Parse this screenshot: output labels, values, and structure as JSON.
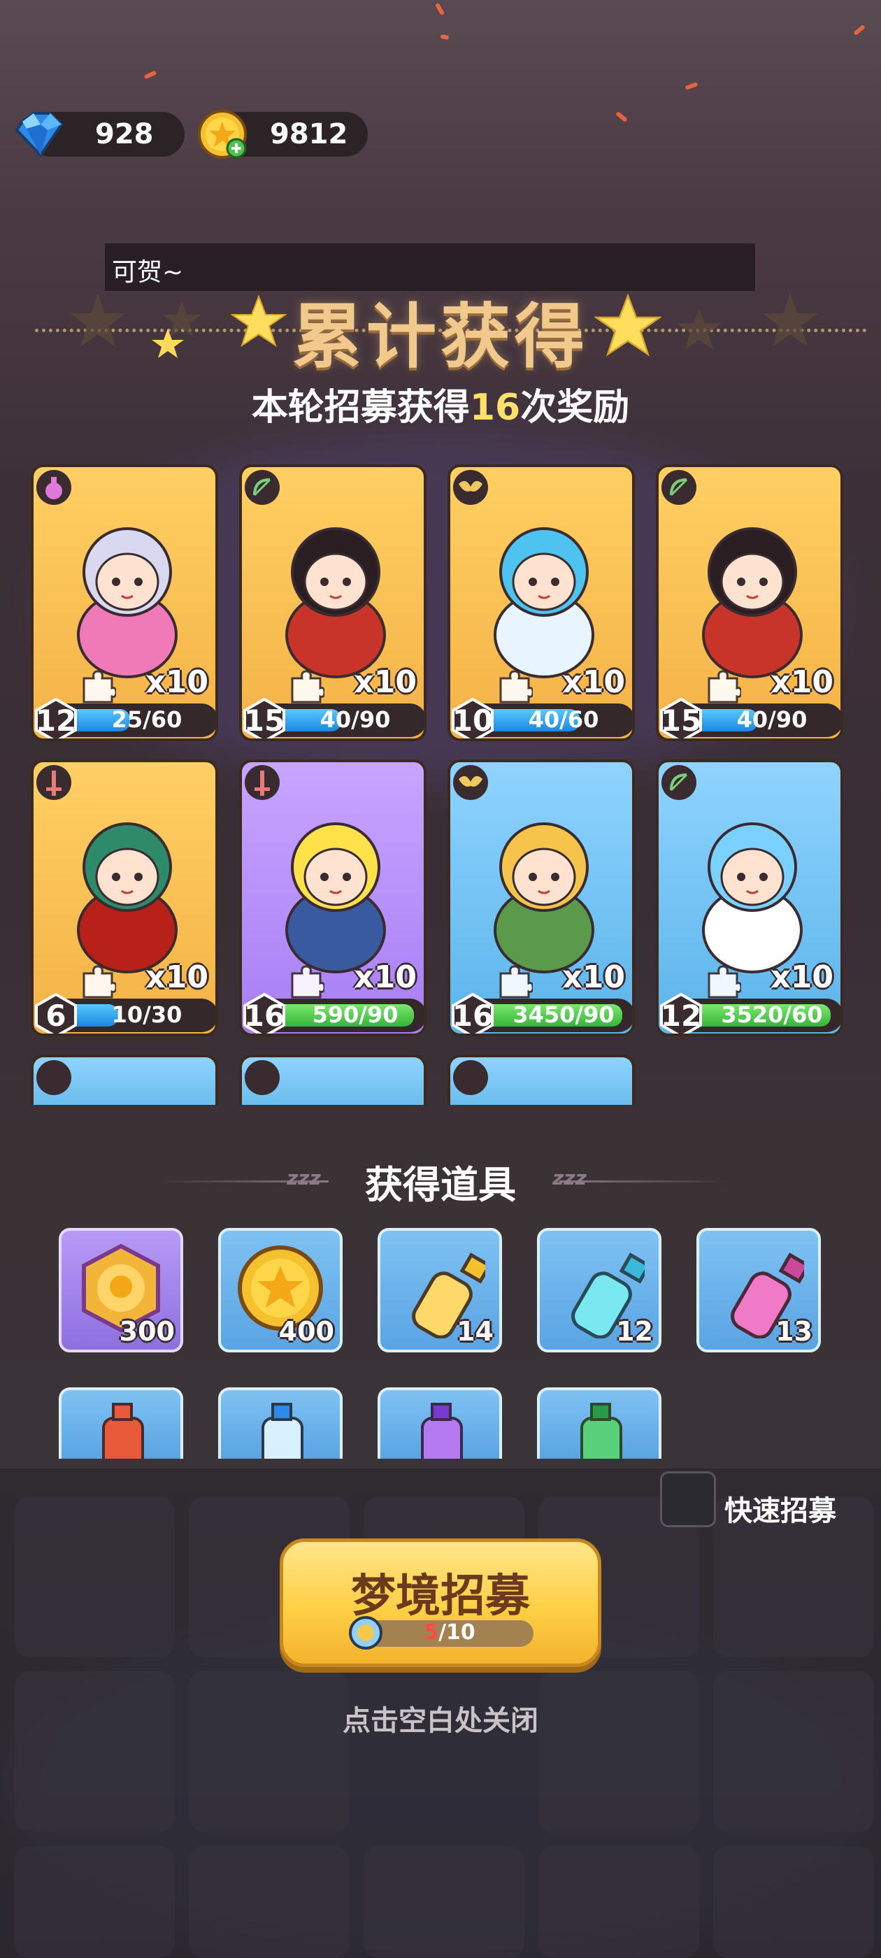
{
  "currency": {
    "gems": "928",
    "coins": "9812"
  },
  "notice": {
    "text": "可贺~"
  },
  "header": {
    "title": "累计获得",
    "subtitle_prefix": "本轮招募获得",
    "subtitle_count": "16",
    "subtitle_suffix": "次奖励"
  },
  "heroes": [
    {
      "role_icon": "potion-role-icon",
      "rarity": "gold",
      "count": "x10",
      "level": "12",
      "progress": "25/60",
      "progress_fraction": 0.42,
      "bar_color": "blue"
    },
    {
      "role_icon": "bow-role-icon",
      "rarity": "gold",
      "count": "x10",
      "level": "15",
      "progress": "40/90",
      "progress_fraction": 0.44,
      "bar_color": "blue"
    },
    {
      "role_icon": "wing-role-icon",
      "rarity": "gold",
      "count": "x10",
      "level": "10",
      "progress": "40/60",
      "progress_fraction": 0.67,
      "bar_color": "blue"
    },
    {
      "role_icon": "bow-role-icon",
      "rarity": "gold",
      "count": "x10",
      "level": "15",
      "progress": "40/90",
      "progress_fraction": 0.44,
      "bar_color": "blue"
    },
    {
      "role_icon": "sword-role-icon",
      "rarity": "gold",
      "count": "x10",
      "level": "6",
      "progress": "10/30",
      "progress_fraction": 0.33,
      "bar_color": "blue"
    },
    {
      "role_icon": "sword-role-icon",
      "rarity": "purple",
      "count": "x10",
      "level": "16",
      "progress": "590/90",
      "progress_fraction": 1.0,
      "bar_color": "green"
    },
    {
      "role_icon": "wing-role-icon",
      "rarity": "blue",
      "count": "x10",
      "level": "16",
      "progress": "3450/90",
      "progress_fraction": 1.0,
      "bar_color": "green"
    },
    {
      "role_icon": "bow-role-icon",
      "rarity": "blue",
      "count": "x10",
      "level": "12",
      "progress": "3520/60",
      "progress_fraction": 1.0,
      "bar_color": "green"
    }
  ],
  "heroes_partial_row": [
    "wing-role-icon",
    "magic-role-icon",
    "bow-role-icon"
  ],
  "items_section": {
    "title": "获得道具"
  },
  "items": [
    {
      "icon": "hero-medal-icon",
      "rarity": "purple",
      "qty": "300"
    },
    {
      "icon": "gold-coin-icon",
      "rarity": "blue",
      "qty": "400"
    },
    {
      "icon": "yellow-bottle-icon",
      "rarity": "blue",
      "qty": "14"
    },
    {
      "icon": "cyan-bottle-icon",
      "rarity": "blue",
      "qty": "12"
    },
    {
      "icon": "pink-bottle-icon",
      "rarity": "blue",
      "qty": "13"
    }
  ],
  "items_partial_row": [
    "red-bottle-icon",
    "blue-bottle-icon",
    "purple-bottle-icon",
    "green-bottle-icon"
  ],
  "quick_recruit": {
    "label": "快速招募",
    "checked": false
  },
  "recruit_button": {
    "label": "梦境招募",
    "current": "5",
    "total": "/10"
  },
  "close_hint": "点击空白处关闭",
  "colors": {
    "title_gold": "#f1c98d",
    "highlight_yellow": "#ffe16a",
    "bar_blue": "#1c86e0",
    "bar_green": "#35b43a"
  }
}
